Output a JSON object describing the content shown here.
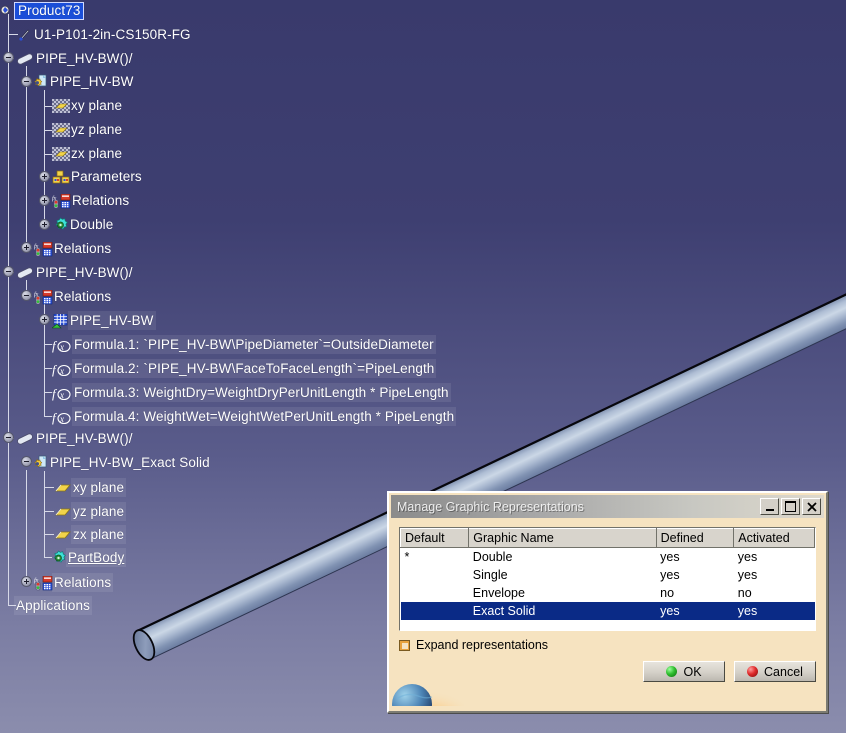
{
  "app": {
    "background_top_color": "#393a6c",
    "background_bottom_color": "#8b8dad",
    "selection_color": "#1b4ed8"
  },
  "spec_tree": {
    "root_label": "Product73",
    "nodes": [
      {
        "label": "Product73",
        "icon": "product-icon",
        "depth": 0,
        "state": "selected",
        "expander": "none"
      },
      {
        "label": "U1-P101-2in-CS150R-FG",
        "icon": "document-icon",
        "depth": 1,
        "state": "normal",
        "expander": "none"
      },
      {
        "label": "PIPE_HV-BW()/",
        "icon": "pipe-icon",
        "depth": 1,
        "state": "normal",
        "expander": "minus"
      },
      {
        "label": "PIPE_HV-BW",
        "icon": "part-icon",
        "depth": 2,
        "state": "normal",
        "expander": "minus"
      },
      {
        "label": "xy plane",
        "icon": "plane-dithered-icon",
        "depth": 3,
        "state": "normal",
        "expander": "none"
      },
      {
        "label": "yz plane",
        "icon": "plane-dithered-icon",
        "depth": 3,
        "state": "normal",
        "expander": "none"
      },
      {
        "label": "zx plane",
        "icon": "plane-dithered-icon",
        "depth": 3,
        "state": "normal",
        "expander": "none"
      },
      {
        "label": "Parameters",
        "icon": "parameters-icon",
        "depth": 3,
        "state": "normal",
        "expander": "plus"
      },
      {
        "label": "Relations",
        "icon": "relations-icon",
        "depth": 3,
        "state": "normal",
        "expander": "plus"
      },
      {
        "label": "Double",
        "icon": "double-icon",
        "depth": 3,
        "state": "normal",
        "expander": "plus"
      },
      {
        "label": "Relations",
        "icon": "relations-icon",
        "depth": 2,
        "state": "normal",
        "expander": "plus"
      },
      {
        "label": "PIPE_HV-BW()/",
        "icon": "pipe-icon",
        "depth": 1,
        "state": "normal",
        "expander": "minus"
      },
      {
        "label": "Relations",
        "icon": "relations-icon",
        "depth": 2,
        "state": "normal",
        "expander": "minus"
      },
      {
        "label": "PIPE_HV-BW",
        "icon": "grid-icon",
        "depth": 3,
        "state": "highlight",
        "expander": "plus"
      },
      {
        "label": "Formula.1: `PIPE_HV-BW\\PipeDiameter`=OutsideDiameter",
        "icon": "formula-icon",
        "depth": 3,
        "state": "highlight",
        "expander": "none"
      },
      {
        "label": "Formula.2: `PIPE_HV-BW\\FaceToFaceLength`=PipeLength",
        "icon": "formula-icon",
        "depth": 3,
        "state": "highlight",
        "expander": "none"
      },
      {
        "label": "Formula.3: WeightDry=WeightDryPerUnitLength * PipeLength",
        "icon": "formula-icon",
        "depth": 3,
        "state": "highlight",
        "expander": "none"
      },
      {
        "label": "Formula.4: WeightWet=WeightWetPerUnitLength * PipeLength",
        "icon": "formula-icon",
        "depth": 3,
        "state": "highlight",
        "expander": "none"
      },
      {
        "label": "PIPE_HV-BW()/",
        "icon": "pipe-icon",
        "depth": 1,
        "state": "normal",
        "expander": "minus"
      },
      {
        "label": "PIPE_HV-BW_Exact Solid",
        "icon": "part-icon",
        "depth": 2,
        "state": "normal",
        "expander": "minus"
      },
      {
        "label": "xy plane",
        "icon": "plane-icon",
        "depth": 3,
        "state": "highlight",
        "expander": "none"
      },
      {
        "label": "yz plane",
        "icon": "plane-icon",
        "depth": 3,
        "state": "highlight",
        "expander": "none"
      },
      {
        "label": "zx plane",
        "icon": "plane-icon",
        "depth": 3,
        "state": "highlight",
        "expander": "none"
      },
      {
        "label": "PartBody",
        "icon": "double-icon",
        "depth": 3,
        "state": "underline",
        "expander": "none"
      },
      {
        "label": "Relations",
        "icon": "relations-icon",
        "depth": 2,
        "state": "highlight",
        "expander": "plus"
      },
      {
        "label": "Applications",
        "icon": "none",
        "depth": 1,
        "state": "highlight",
        "expander": "none"
      }
    ]
  },
  "dialog": {
    "title": "Manage Graphic Representations",
    "titlebar_buttons": [
      {
        "name": "minimize",
        "glyph": "_"
      },
      {
        "name": "maximize",
        "glyph": "□"
      },
      {
        "name": "close",
        "glyph": "✕"
      }
    ],
    "table": {
      "columns": [
        "Default",
        "Graphic Name",
        "Defined",
        "Activated"
      ],
      "rows": [
        {
          "default": "*",
          "graphic_name": "Double",
          "defined": "yes",
          "activated": "yes",
          "selected": false
        },
        {
          "default": "",
          "graphic_name": "Single",
          "defined": "yes",
          "activated": "yes",
          "selected": false
        },
        {
          "default": "",
          "graphic_name": "Envelope",
          "defined": "no",
          "activated": "no",
          "selected": false
        },
        {
          "default": "",
          "graphic_name": "Exact Solid",
          "defined": "yes",
          "activated": "yes",
          "selected": true
        }
      ]
    },
    "expand_checkbox": {
      "label": "Expand representations",
      "checked": false
    },
    "ok_label": "OK",
    "cancel_label": "Cancel"
  }
}
